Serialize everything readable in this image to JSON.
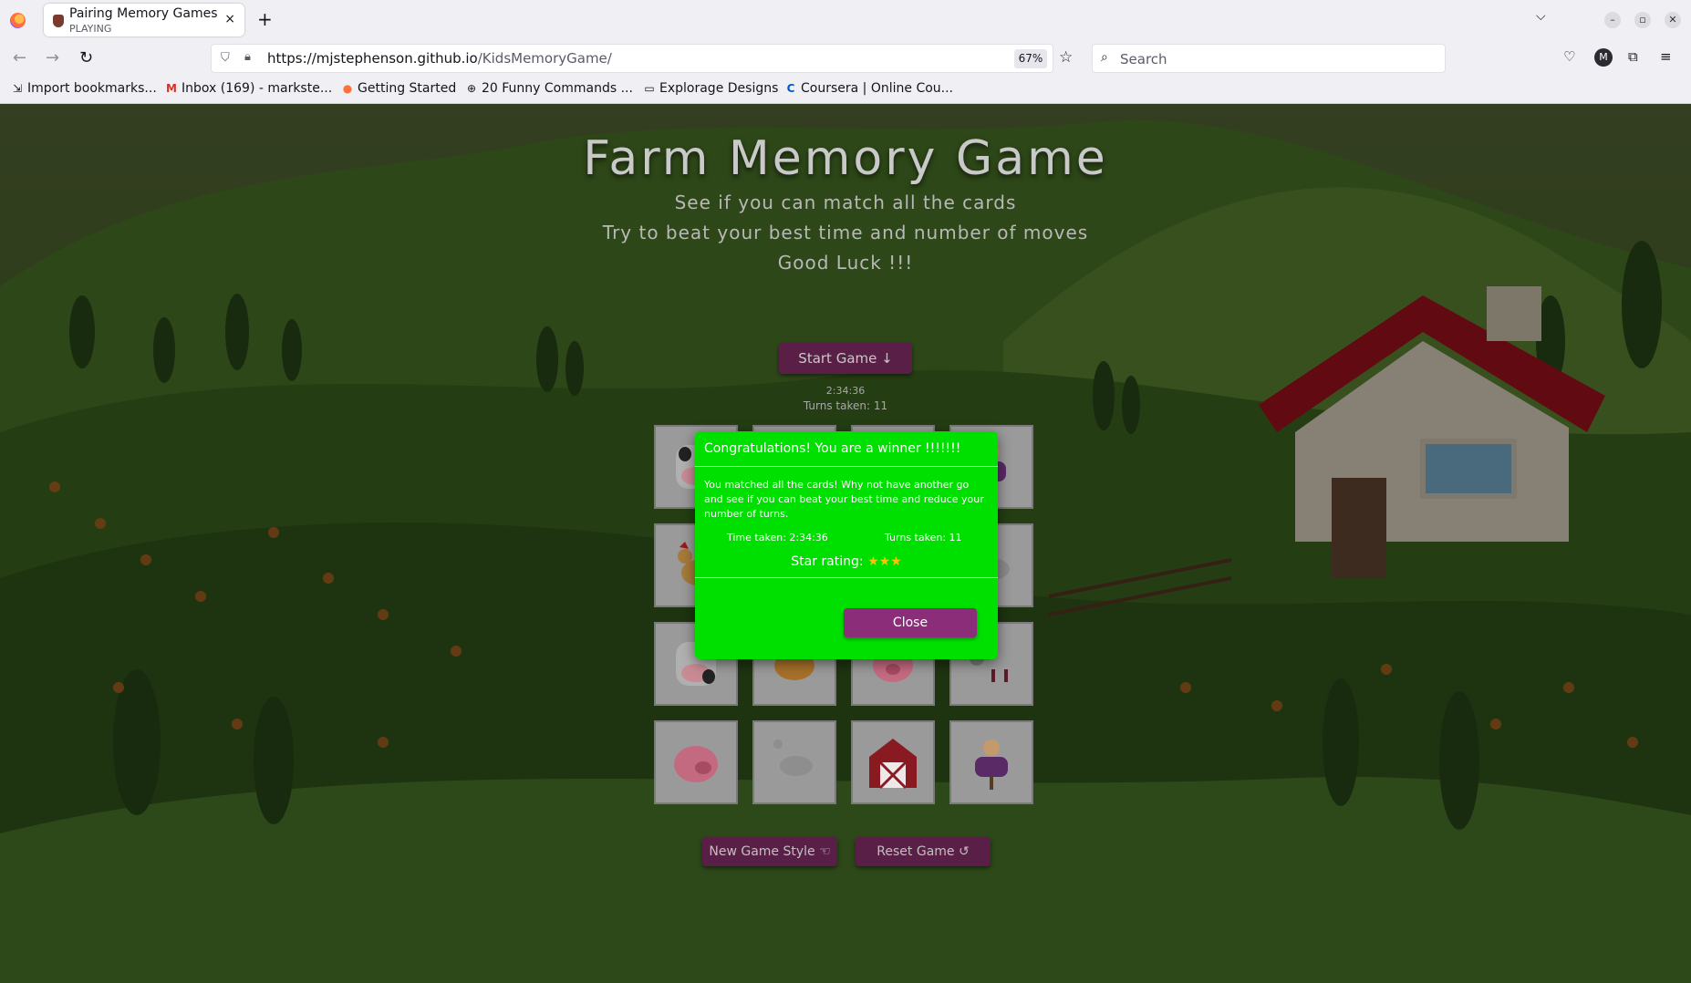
{
  "browser": {
    "tab": {
      "title": "Pairing Memory Games",
      "subtitle": "PLAYING",
      "close": "×"
    },
    "new_tab": "+",
    "url_host": "https://mjstephenson.github.io",
    "url_path": "/KidsMemoryGame/",
    "zoom": "67%",
    "search_placeholder": "Search",
    "avatar_letter": "M",
    "bookmarks": [
      "Import bookmarks...",
      "Inbox (169) - markste...",
      "Getting Started",
      "20 Funny Commands ...",
      "Explorage Designs",
      "Coursera | Online Cou..."
    ]
  },
  "game": {
    "title": "Farm Memory Game",
    "lines": [
      "See if you can match all the cards",
      "Try to beat your best time and number of moves",
      "Good Luck !!!"
    ],
    "start_button": "Start Game ↓",
    "timer": "2:34:36",
    "turns": "Turns taken: 11",
    "new_game_style": "New Game Style ☜",
    "reset_game": "Reset Game ↺",
    "cards": [
      "cow",
      "",
      "",
      "scarecrow",
      "chicken",
      "",
      "",
      "goose",
      "cow",
      "chicken",
      "pig",
      "sheep",
      "pig",
      "goose",
      "barn",
      "scarecrow"
    ]
  },
  "modal": {
    "heading": "Congratulations! You are a winner !!!!!!!",
    "body": "You matched all the cards! Why not have another go and see if you can beat your best time and reduce your number of turns.",
    "time_taken": "Time taken: 2:34:36",
    "turns_taken": "Turns taken: 11",
    "rating_label": "Star rating: ",
    "stars": "★★★",
    "close_label": "Close"
  },
  "colors": {
    "modal_bg": "#00e000",
    "button_purple": "#8b2d78",
    "star_gold": "#ffc107"
  }
}
